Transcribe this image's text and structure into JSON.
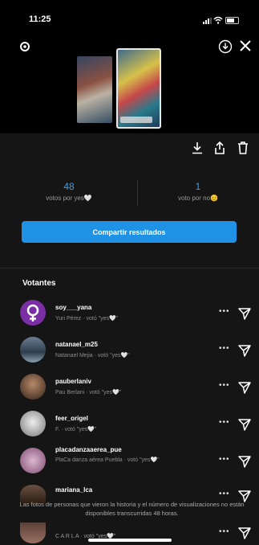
{
  "status_bar": {
    "time": "11:25"
  },
  "stats": [
    {
      "count": "48",
      "label": "votos por yes🤍"
    },
    {
      "count": "1",
      "label": "voto por no😊"
    }
  ],
  "share_button": "Compartir resultados",
  "section_title": "Votantes",
  "voters": [
    {
      "username": "soy___yana",
      "detail": "Yuri Pérez · votó \"yes🤍\""
    },
    {
      "username": "natanael_m25",
      "detail": "Natanael Mejia · votó \"yes🤍\""
    },
    {
      "username": "pauberlaniv",
      "detail": "Pau Berlani · votó \"yes🤍\""
    },
    {
      "username": "feer_origel",
      "detail": "F. · votó \"yes🤍\""
    },
    {
      "username": "placadanzaaerea_pue",
      "detail": "PlaCa danza aérea Puebla · votó \"yes🤍\""
    },
    {
      "username": "mariana_lca",
      "detail": ""
    },
    {
      "username": "",
      "detail": "C A R L A · votó \"yes🤍\""
    }
  ],
  "footer_note": "Las fotos de personas que vieron la historia y el número de visualizaciones no están disponibles transcurridas 48 horas.",
  "colors": {
    "accent": "#1f92e6",
    "count": "#3b9ded"
  }
}
